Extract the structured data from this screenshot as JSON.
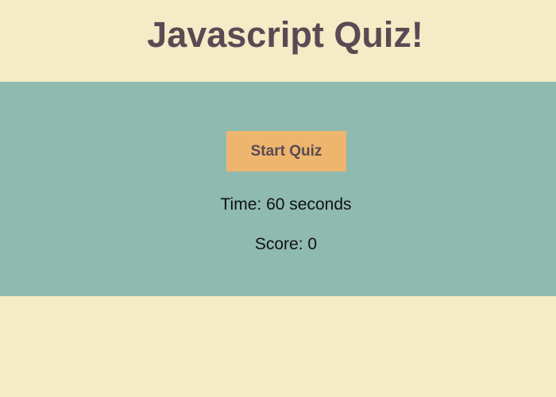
{
  "header": {
    "title": "Javascript Quiz!"
  },
  "quiz": {
    "start_label": "Start Quiz",
    "time_label": "Time:",
    "time_value": "60",
    "time_unit": "seconds",
    "score_label": "Score:",
    "score_value": "0"
  },
  "colors": {
    "page_background": "#f5ebc6",
    "panel_background": "#8fbab0",
    "button_background": "#eeb56f",
    "title_text": "#594b53"
  }
}
